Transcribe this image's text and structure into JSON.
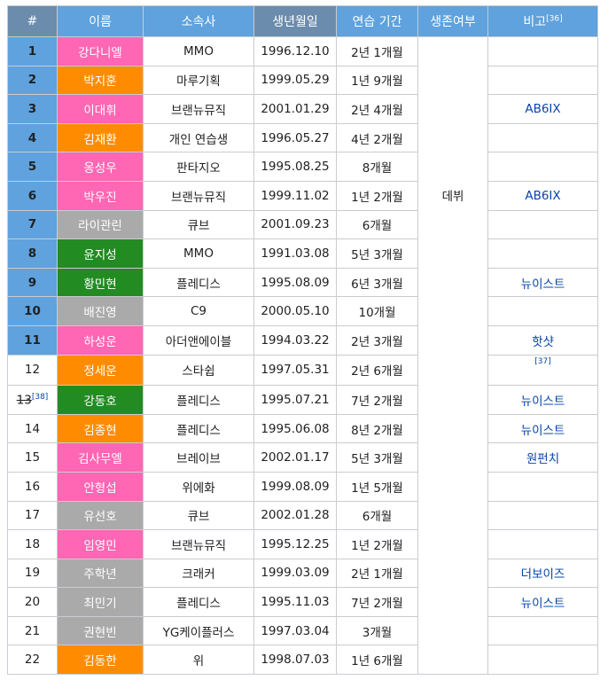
{
  "headers": {
    "num": "#",
    "name": "이름",
    "agency": "소속사",
    "birth": "생년월일",
    "period": "연습 기간",
    "status": "생존여부",
    "note": "비고",
    "note_ref": "[36]"
  },
  "status_value": "데뷔",
  "colors": {
    "header_blue": "#5fa2dd",
    "header_dark": "#6b8cac",
    "pink": "#ff66b3",
    "orange": "#ff8c00",
    "gray": "#aaaaaa",
    "green": "#228b22",
    "link": "#0645ad"
  },
  "rows": [
    {
      "num": "1",
      "name": "강다니엘",
      "agency": "MMO",
      "birth": "1996.12.10",
      "period": "2년 1개월",
      "note": "",
      "color": "pink"
    },
    {
      "num": "2",
      "name": "박지훈",
      "agency": "마루기획",
      "birth": "1999.05.29",
      "period": "1년 9개월",
      "note": "",
      "color": "orange"
    },
    {
      "num": "3",
      "name": "이대휘",
      "agency": "브랜뉴뮤직",
      "birth": "2001.01.29",
      "period": "2년 4개월",
      "note": "AB6IX",
      "color": "pink"
    },
    {
      "num": "4",
      "name": "김재환",
      "agency": "개인 연습생",
      "birth": "1996.05.27",
      "period": "4년 2개월",
      "note": "",
      "color": "orange"
    },
    {
      "num": "5",
      "name": "옹성우",
      "agency": "판타지오",
      "birth": "1995.08.25",
      "period": "8개월",
      "note": "",
      "color": "pink"
    },
    {
      "num": "6",
      "name": "박우진",
      "agency": "브랜뉴뮤직",
      "birth": "1999.11.02",
      "period": "1년 2개월",
      "note": "AB6IX",
      "color": "pink"
    },
    {
      "num": "7",
      "name": "라이관린",
      "agency": "큐브",
      "birth": "2001.09.23",
      "period": "6개월",
      "note": "",
      "color": "gray"
    },
    {
      "num": "8",
      "name": "윤지성",
      "agency": "MMO",
      "birth": "1991.03.08",
      "period": "5년 3개월",
      "note": "",
      "color": "green"
    },
    {
      "num": "9",
      "name": "황민현",
      "agency": "플레디스",
      "birth": "1995.08.09",
      "period": "6년 3개월",
      "note": "뉴이스트",
      "color": "green"
    },
    {
      "num": "10",
      "name": "배진영",
      "agency": "C9",
      "birth": "2000.05.10",
      "period": "10개월",
      "note": "",
      "color": "gray"
    },
    {
      "num": "11",
      "name": "하성운",
      "agency": "아더앤에이블",
      "birth": "1994.03.22",
      "period": "2년 3개월",
      "note": "핫샷",
      "color": "pink"
    },
    {
      "num": "12",
      "name": "정세운",
      "agency": "스타쉽",
      "birth": "1997.05.31",
      "period": "2년 6개월",
      "note": "[37]",
      "color": "orange"
    },
    {
      "num": "13",
      "num_ref": "[38]",
      "name": "강동호",
      "agency": "플레디스",
      "birth": "1995.07.21",
      "period": "7년 2개월",
      "note": "뉴이스트",
      "color": "green"
    },
    {
      "num": "14",
      "name": "김종현",
      "agency": "플레디스",
      "birth": "1995.06.08",
      "period": "8년 2개월",
      "note": "뉴이스트",
      "color": "orange"
    },
    {
      "num": "15",
      "name": "김사무엘",
      "agency": "브레이브",
      "birth": "2002.01.17",
      "period": "5년 3개월",
      "note": "원펀치",
      "color": "pink"
    },
    {
      "num": "16",
      "name": "안형섭",
      "agency": "위에화",
      "birth": "1999.08.09",
      "period": "1년 5개월",
      "note": "",
      "color": "pink"
    },
    {
      "num": "17",
      "name": "유선호",
      "agency": "큐브",
      "birth": "2002.01.28",
      "period": "6개월",
      "note": "",
      "color": "gray"
    },
    {
      "num": "18",
      "name": "임영민",
      "agency": "브랜뉴뮤직",
      "birth": "1995.12.25",
      "period": "1년 2개월",
      "note": "",
      "color": "pink"
    },
    {
      "num": "19",
      "name": "주학년",
      "agency": "크래커",
      "birth": "1999.03.09",
      "period": "2년 1개월",
      "note": "더보이즈",
      "color": "gray"
    },
    {
      "num": "20",
      "name": "최민기",
      "agency": "플레디스",
      "birth": "1995.11.03",
      "period": "7년 2개월",
      "note": "뉴이스트",
      "color": "gray"
    },
    {
      "num": "21",
      "name": "권현빈",
      "agency": "YG케이플러스",
      "birth": "1997.03.04",
      "period": "3개월",
      "note": "",
      "color": "gray"
    },
    {
      "num": "22",
      "name": "김동한",
      "agency": "위",
      "birth": "1998.07.03",
      "period": "1년 6개월",
      "note": "",
      "color": "orange"
    }
  ]
}
